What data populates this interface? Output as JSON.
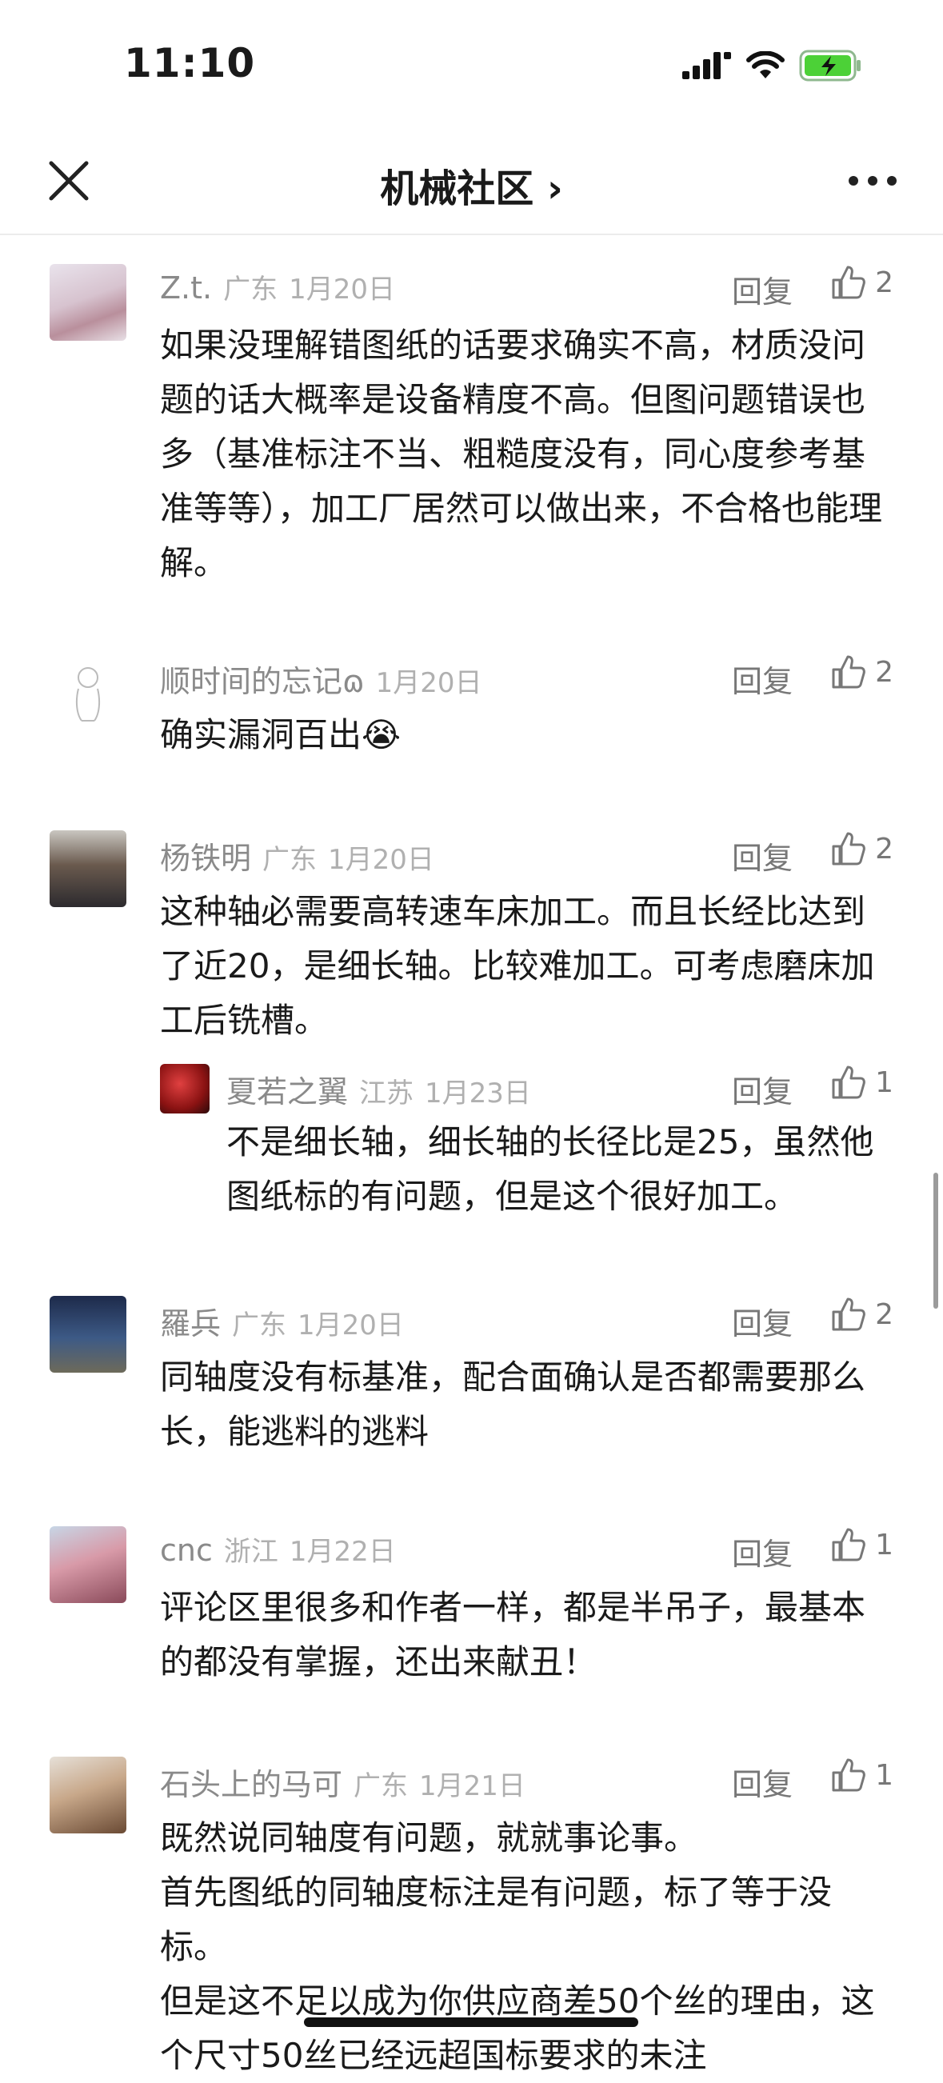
{
  "status_bar": {
    "time": "11:10"
  },
  "nav": {
    "title": "机械社区 ›"
  },
  "comments": [
    {
      "name": "Z.t.",
      "location": "广东",
      "date": "1月20日",
      "reply": "回复",
      "likes": "2",
      "text": "如果没理解错图纸的话要求确实不高，材质没问题的话大概率是设备精度不高。但图问题错误也多（基准标注不当、粗糙度没有，同心度参考基准等等），加工厂居然可以做出来，不合格也能理解。"
    },
    {
      "name": "顺时间的忘记ɷ",
      "location": "",
      "date": "1月20日",
      "reply": "回复",
      "likes": "2",
      "text": "确实漏洞百出😭"
    },
    {
      "name": "杨铁明",
      "location": "广东",
      "date": "1月20日",
      "reply": "回复",
      "likes": "2",
      "text": "这种轴必需要高转速车床加工。而且长经比达到了近20，是细长轴。比较难加工。可考虑磨床加工后铣槽。",
      "replies": [
        {
          "name": "夏若之翼",
          "location": "江苏",
          "date": "1月23日",
          "reply": "回复",
          "likes": "1",
          "text": "不是细长轴，细长轴的长径比是25，虽然他图纸标的有问题，但是这个很好加工。"
        }
      ]
    },
    {
      "name": "羅兵",
      "location": "广东",
      "date": "1月20日",
      "reply": "回复",
      "likes": "2",
      "text": "同轴度没有标基准，配合面确认是否都需要那么长，能逃料的逃料"
    },
    {
      "name": "cnc",
      "location": "浙江",
      "date": "1月22日",
      "reply": "回复",
      "likes": "1",
      "text": "评论区里很多和作者一样，都是半吊子，最基本的都没有掌握，还出来献丑！"
    },
    {
      "name": "石头上的马可",
      "location": "广东",
      "date": "1月21日",
      "reply": "回复",
      "likes": "1",
      "text_lines": [
        "既然说同轴度有问题，就就事论事。",
        "首先图纸的同轴度标注是有问题，标了等于没标。",
        "但是这不足以成为你供应商差50个丝的理由，这个尺寸50丝已经远超国标要求的未注"
      ]
    }
  ]
}
